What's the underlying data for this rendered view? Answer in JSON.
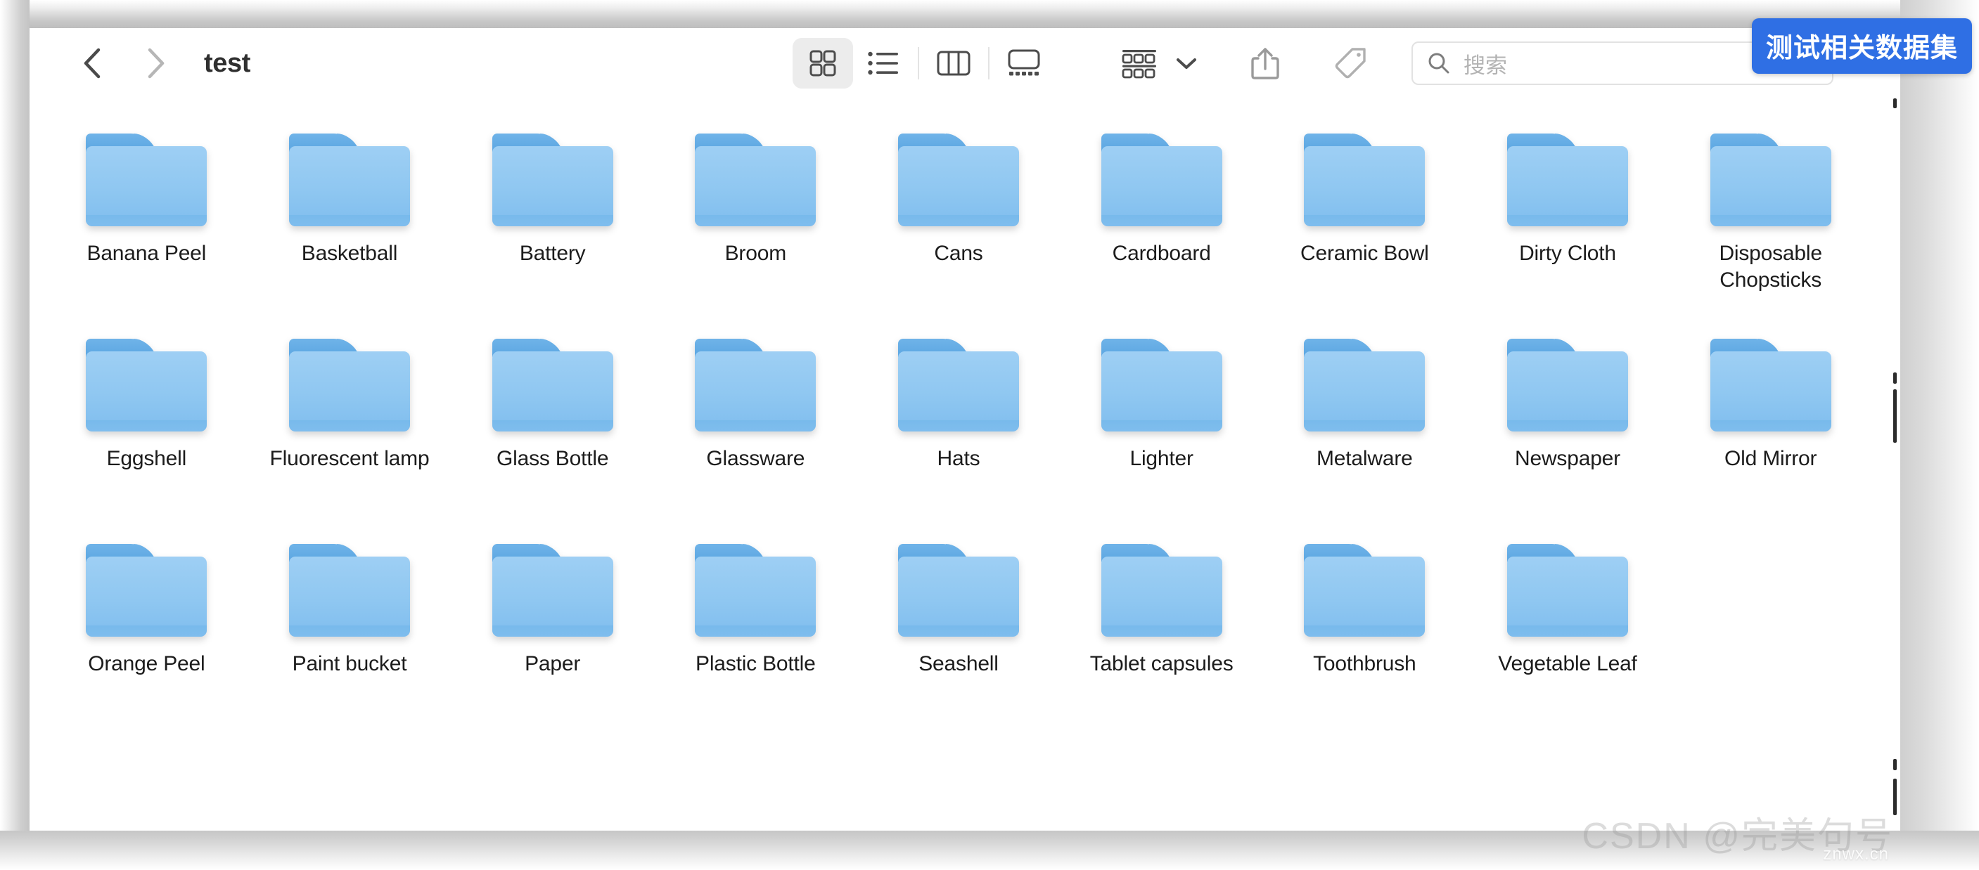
{
  "window": {
    "title": "test"
  },
  "toolbar": {
    "back_icon": "chevron-left-icon",
    "forward_icon": "chevron-right-icon",
    "view_modes": [
      {
        "id": "icon-view",
        "icon": "grid-view-icon",
        "active": true
      },
      {
        "id": "list-view",
        "icon": "list-view-icon",
        "active": false
      },
      {
        "id": "column-view",
        "icon": "column-view-icon",
        "active": false
      },
      {
        "id": "gallery-view",
        "icon": "gallery-view-icon",
        "active": false
      }
    ],
    "group_icon": "group-items-icon",
    "group_chevron_icon": "chevron-down-icon",
    "share_icon": "share-icon",
    "tag_icon": "tag-icon",
    "more_icon": "more-actions-icon",
    "more_chevron_icon": "chevron-down-icon"
  },
  "search": {
    "icon": "search-icon",
    "placeholder": "搜索",
    "value": ""
  },
  "badge": {
    "label": "测试相关数据集",
    "color": "#2f6fe4",
    "text_color": "#ffffff"
  },
  "watermark": {
    "text": "CSDN @完美句号",
    "sub_text": "znwx.cn"
  },
  "folders": [
    {
      "name": "Banana Peel"
    },
    {
      "name": "Basketball"
    },
    {
      "name": "Battery"
    },
    {
      "name": "Broom"
    },
    {
      "name": "Cans"
    },
    {
      "name": "Cardboard"
    },
    {
      "name": "Ceramic Bowl"
    },
    {
      "name": "Dirty Cloth"
    },
    {
      "name": "Disposable Chopsticks"
    },
    {
      "name": "Eggshell"
    },
    {
      "name": "Fluorescent lamp"
    },
    {
      "name": "Glass Bottle"
    },
    {
      "name": "Glassware"
    },
    {
      "name": "Hats"
    },
    {
      "name": "Lighter"
    },
    {
      "name": "Metalware"
    },
    {
      "name": "Newspaper"
    },
    {
      "name": "Old Mirror"
    },
    {
      "name": "Orange Peel"
    },
    {
      "name": "Paint bucket"
    },
    {
      "name": "Paper"
    },
    {
      "name": "Plastic Bottle"
    },
    {
      "name": "Seashell"
    },
    {
      "name": "Tablet capsules"
    },
    {
      "name": "Toothbrush"
    },
    {
      "name": "Vegetable Leaf"
    }
  ]
}
